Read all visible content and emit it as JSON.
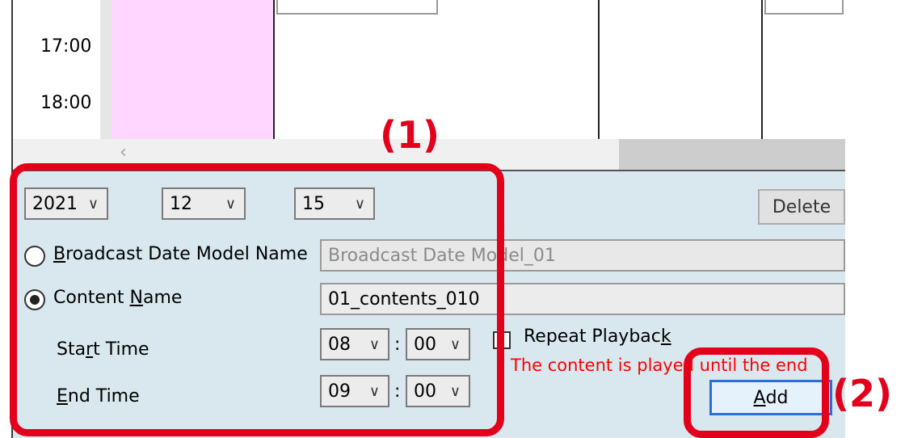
{
  "schedule": {
    "times": [
      "17:00",
      "18:00"
    ],
    "scroll_left_arrow": "‹"
  },
  "form": {
    "year": "2021",
    "month": "12",
    "day": "15",
    "delete_label": "Delete",
    "broadcast_model": {
      "label_underlined": "B",
      "label_rest": "roadcast Date Model Name",
      "value": "Broadcast Date Model_01",
      "selected": false
    },
    "content": {
      "label_prefix": "Content ",
      "label_underlined": "N",
      "label_rest": "ame",
      "value": "01_contents_010",
      "selected": true
    },
    "start_time": {
      "label_prefix": "Sta",
      "label_underlined": "r",
      "label_rest": "t Time",
      "hour": "08",
      "minute": "00"
    },
    "end_time": {
      "label_underlined": "E",
      "label_rest": "nd Time",
      "hour": "09",
      "minute": "00"
    },
    "time_separator": ":",
    "repeat_playback": {
      "label_prefix": "Repeat Playbac",
      "label_underlined": "k",
      "checked": false
    },
    "notice": "The content is played until the end",
    "add": {
      "label_underlined": "A",
      "label_rest": "dd"
    }
  },
  "annotations": {
    "callout_1": "(1)",
    "callout_2": "(2)",
    "color": "#e3001b"
  },
  "colors": {
    "panel_bg": "#d9e8ee",
    "pink_column": "#ffd6ff",
    "notice_red": "#ff0000"
  }
}
